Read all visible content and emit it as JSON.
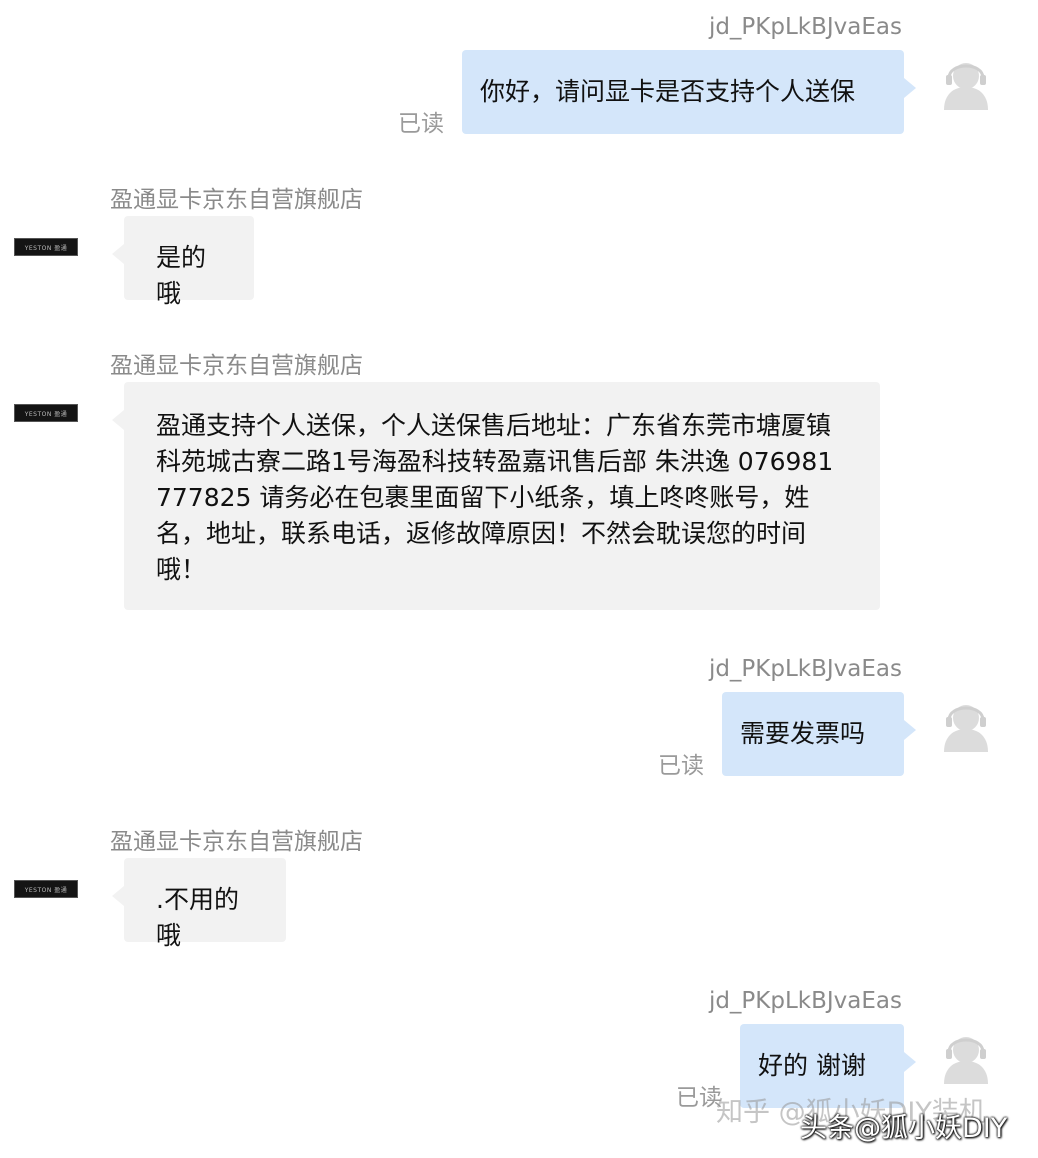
{
  "conversation": {
    "messages": [
      {
        "side": "right",
        "sender": "jd_PKpLkBJvaEas",
        "text": "你好，请问显卡是否支持个人送保",
        "status": "已读"
      },
      {
        "side": "left",
        "sender": "盈通显卡京东自营旗舰店",
        "text": "是的哦"
      },
      {
        "side": "left",
        "sender": "盈通显卡京东自营旗舰店",
        "lines": [
          "盈通支持个人送保，个人送保售后地址：广东省东莞市塘厦镇",
          "科苑城古寮二路1号海盈科技转盈嘉讯售后部 朱洪逸 076981",
          "777825 请务必在包裹里面留下小纸条，填上咚咚账号，姓",
          "名，地址，联系电话，返修故障原因！不然会耽误您的时间",
          "哦！"
        ]
      },
      {
        "side": "right",
        "sender": "jd_PKpLkBJvaEas",
        "text": "需要发票吗",
        "status": "已读"
      },
      {
        "side": "left",
        "sender": "盈通显卡京东自营旗舰店",
        "text": ".不用的哦"
      },
      {
        "side": "right",
        "sender": "jd_PKpLkBJvaEas",
        "text": "好的 谢谢",
        "status": "已读"
      }
    ]
  },
  "watermark": {
    "zhihu_text": "知乎 @狐小妖DIY装机",
    "toutiao_text": "头条@狐小妖DIY"
  },
  "icons": {
    "shop_avatar": "shop-logo-avatar",
    "user_avatar": "default-user-avatar-icon"
  },
  "colors": {
    "outgoing_bubble": "#d4e6fa",
    "incoming_bubble": "#f2f2f2",
    "meta_text": "#8a8a8a"
  }
}
